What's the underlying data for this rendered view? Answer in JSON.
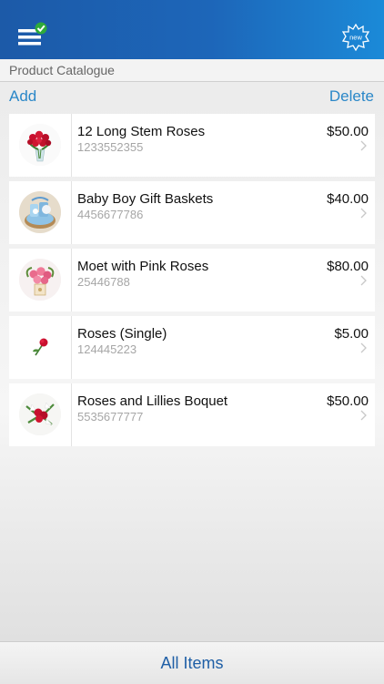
{
  "header": {
    "menu_icon": "menu-check-icon",
    "new_icon": "new-starburst-icon",
    "new_label": "new",
    "accent": "#1d66b9"
  },
  "catalogue": {
    "title": "Product Catalogue",
    "add_label": "Add",
    "delete_label": "Delete",
    "link_color": "#2a87c8"
  },
  "products": [
    {
      "name": "12 Long Stem Roses",
      "code": "1233552355",
      "price": "$50.00",
      "image": "red-roses-vase"
    },
    {
      "name": "Baby Boy Gift Baskets",
      "code": "4456677786",
      "price": "$40.00",
      "image": "blue-gift-basket"
    },
    {
      "name": "Moet with Pink Roses",
      "code": "25446788",
      "price": "$80.00",
      "image": "pink-roses-bouquet"
    },
    {
      "name": "Roses (Single)",
      "code": "124445223",
      "price": "$5.00",
      "image": "single-red-rose"
    },
    {
      "name": "Roses and Lillies Boquet",
      "code": "5535677777",
      "price": "$50.00",
      "image": "roses-lilies-bouquet"
    }
  ],
  "footer": {
    "label": "All Items",
    "color": "#1f5fa6"
  }
}
